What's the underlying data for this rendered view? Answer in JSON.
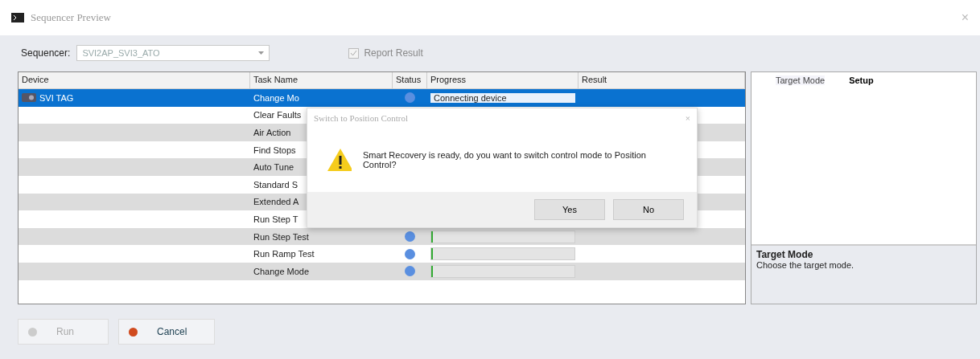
{
  "window": {
    "title": "Sequencer Preview",
    "close": "×"
  },
  "sequencer": {
    "label": "Sequencer:",
    "value": "SVI2AP_SVI3_ATO",
    "disabled": true
  },
  "report_result": {
    "label": "Report Result",
    "checked": true
  },
  "table": {
    "columns": [
      "Device",
      "Task Name",
      "Status",
      "Progress",
      "Result"
    ],
    "rows": [
      {
        "device": "SVI TAG",
        "task": "Change Mo",
        "status_icon": true,
        "progress_text": "Connecting device",
        "selected": true
      },
      {
        "task": "Clear Faults",
        "selected": false
      },
      {
        "task": "Air Action",
        "selected": false
      },
      {
        "task": "Find Stops",
        "selected": false
      },
      {
        "task": "Auto Tune",
        "selected": false
      },
      {
        "task": "Standard S",
        "selected": false
      },
      {
        "task": "Extended A",
        "selected": false
      },
      {
        "task": "Run Step T",
        "selected": false
      },
      {
        "task": "Run Step Test",
        "status_icon": true,
        "level": 0.01,
        "selected": false
      },
      {
        "task": "Run Ramp Test",
        "status_icon": true,
        "level": 0.01,
        "selected": false
      },
      {
        "task": "Change Mode",
        "status_icon": true,
        "level": 0.01,
        "selected": false
      }
    ]
  },
  "side_panel": {
    "tabs": [
      {
        "label": "Target Mode",
        "selected": false
      },
      {
        "label": "Setup",
        "selected": true
      }
    ],
    "help_title": "Target Mode",
    "help_text": "Choose the target mode."
  },
  "buttons": [
    {
      "label": "Run",
      "disabled": true
    },
    {
      "label": "Cancel",
      "disabled": false
    }
  ],
  "dialog": {
    "title": "Switch to Position Control",
    "close": "×",
    "message": "Smart Recovery is ready, do you want to switch control mode to Position Control?",
    "buttons": [
      "Yes",
      "No"
    ]
  }
}
